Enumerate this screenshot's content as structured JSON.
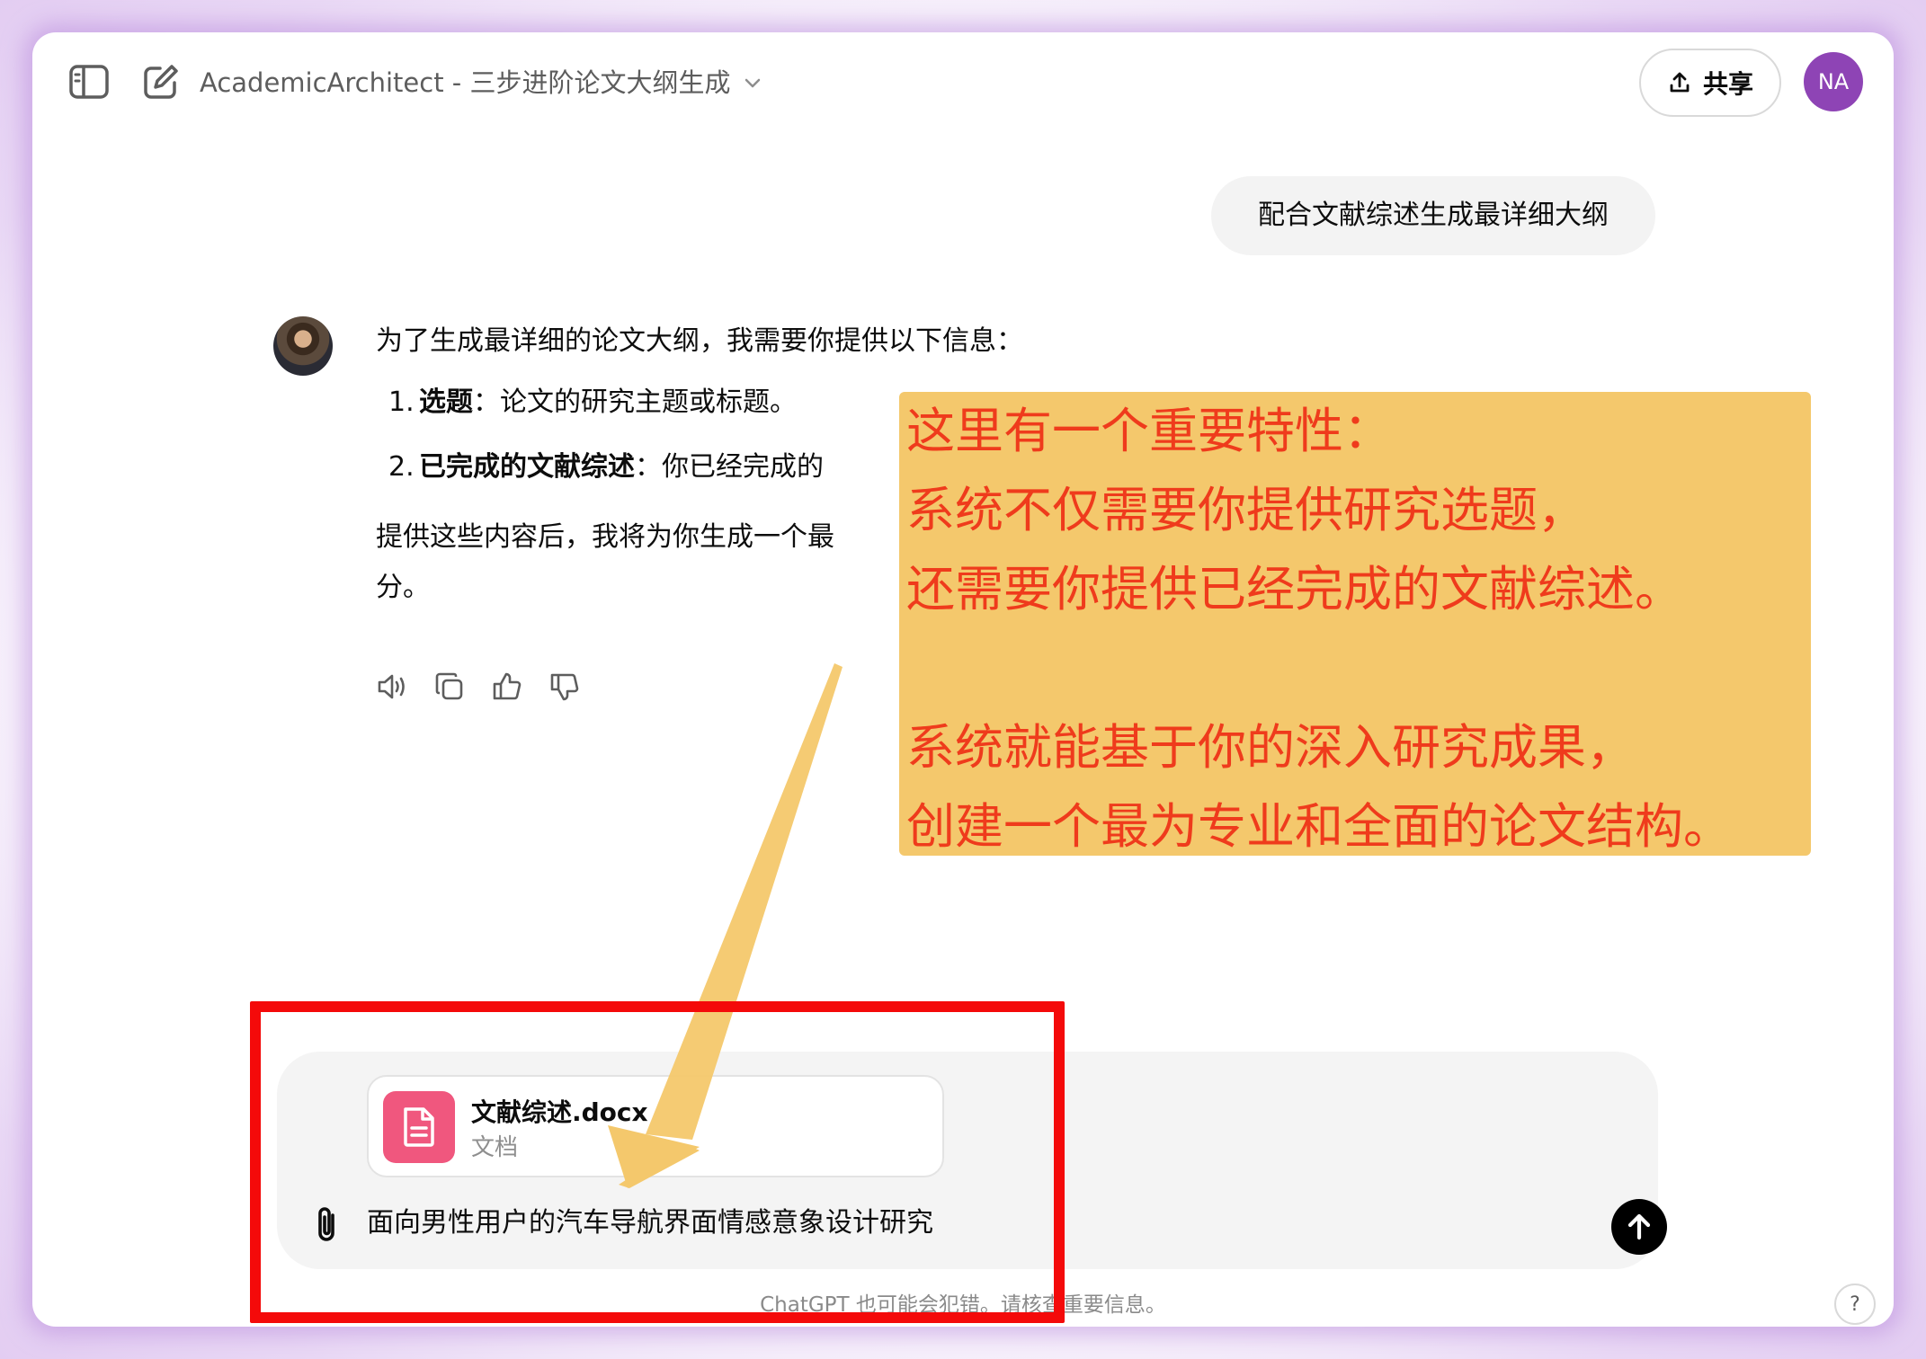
{
  "header": {
    "model_title": "AcademicArchitect - 三步进阶论文大纲生成",
    "share_label": "共享",
    "user_initials": "NA"
  },
  "user_message": "配合文献综述生成最详细大纲",
  "assistant": {
    "intro": "为了生成最详细的论文大纲，我需要你提供以下信息：",
    "items": [
      {
        "num": "1.",
        "key": "选题",
        "sep": "：",
        "text": "论文的研究主题或标题。"
      },
      {
        "num": "2.",
        "key": "已完成的文献综述",
        "sep": "：",
        "text": "你已经完成的"
      }
    ],
    "after_line1": "提供这些内容后，我将为你生成一个最",
    "after_line2": "分。"
  },
  "composer": {
    "file_name": "文献综述.docx",
    "file_type": "文档",
    "input_value": "面向男性用户的汽车导航界面情感意象设计研究"
  },
  "disclaimer": "ChatGPT 也可能会犯错。请核查重要信息。",
  "help_label": "?",
  "annotation": {
    "lines": [
      "这里有一个重要特性：",
      "系统不仅需要你提供研究选题，",
      "还需要你提供已经完成的文献综述。",
      "",
      "系统就能基于你的深入研究成果，",
      "创建一个最为专业和全面的论文结构。"
    ],
    "text_color": "#ef3b1c",
    "box_color": "#f4c86c",
    "frame_color": "#f40a0a"
  },
  "colors": {
    "avatar_user": "#8e44b5",
    "file_icon": "#f0577e"
  }
}
